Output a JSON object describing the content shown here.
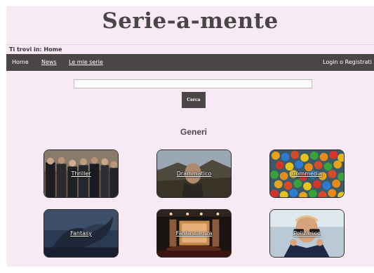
{
  "site": {
    "title": "Serie-a-mente"
  },
  "breadcrumb": "Ti trovi in: Home",
  "nav": {
    "home": "Home",
    "news": "News",
    "my_series": "Le mie serie",
    "login": "Login o Registrati"
  },
  "search": {
    "button_label": "Cerca",
    "value": "",
    "placeholder": ""
  },
  "genres": {
    "title": "Generi",
    "items": [
      {
        "label": "Thriller"
      },
      {
        "label": "Drammatico"
      },
      {
        "label": "Commedia"
      },
      {
        "label": "Fantasy"
      },
      {
        "label": "Fantascienza"
      },
      {
        "label": "Poliziesco"
      }
    ]
  }
}
